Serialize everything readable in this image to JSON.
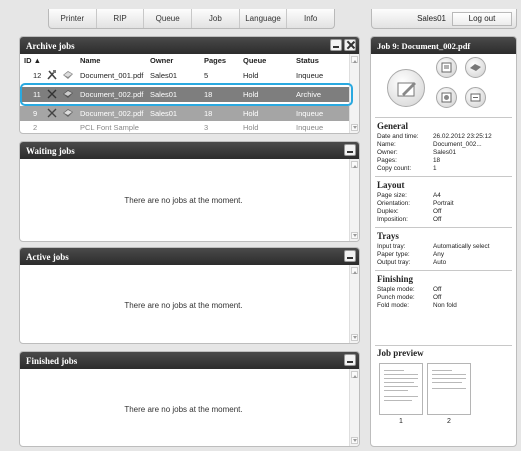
{
  "nav": {
    "tabs": [
      "Printer",
      "RIP",
      "Queue",
      "Job",
      "Language",
      "Info"
    ],
    "user": "Sales01",
    "logout": "Log out"
  },
  "archive": {
    "title": "Archive jobs",
    "columns": [
      "ID ▲",
      "Name",
      "Owner",
      "Pages",
      "Queue",
      "Status"
    ],
    "rows": [
      {
        "id": "12",
        "name": "Document_001.pdf",
        "owner": "Sales01",
        "pages": "5",
        "queue": "Hold",
        "status": "Inqueue"
      },
      {
        "id": "11",
        "name": "Document_002.pdf",
        "owner": "Sales01",
        "pages": "18",
        "queue": "Hold",
        "status": "Archive"
      },
      {
        "id": "9",
        "name": "Document_002.pdf",
        "owner": "Sales01",
        "pages": "18",
        "queue": "Hold",
        "status": "Inqueue"
      },
      {
        "id": "2",
        "name": "PCL Font Sample",
        "owner": "",
        "pages": "3",
        "queue": "Hold",
        "status": "Inqueue"
      }
    ]
  },
  "waiting": {
    "title": "Waiting jobs",
    "empty": "There are no jobs at the moment."
  },
  "active": {
    "title": "Active jobs",
    "empty": "There are no jobs at the moment."
  },
  "finished": {
    "title": "Finished jobs",
    "empty": "There are no jobs at the moment."
  },
  "job": {
    "title": "Job 9: Document_002.pdf",
    "general": {
      "title": "General",
      "items": [
        {
          "k": "Date and time:",
          "v": "26.02.2012 23:25:12"
        },
        {
          "k": "Name:",
          "v": "Document_002..."
        },
        {
          "k": "Owner:",
          "v": "Sales01"
        },
        {
          "k": "Pages:",
          "v": "18"
        },
        {
          "k": "Copy count:",
          "v": "1"
        }
      ]
    },
    "layout": {
      "title": "Layout",
      "items": [
        {
          "k": "Page size:",
          "v": "A4"
        },
        {
          "k": "Orientation:",
          "v": "Portrait"
        },
        {
          "k": "Duplex:",
          "v": "Off"
        },
        {
          "k": "Imposition:",
          "v": "Off"
        }
      ]
    },
    "trays": {
      "title": "Trays",
      "items": [
        {
          "k": "Input tray:",
          "v": "Automatically select"
        },
        {
          "k": "Paper type:",
          "v": "Any"
        },
        {
          "k": "Output tray:",
          "v": "Auto"
        }
      ]
    },
    "finishing": {
      "title": "Finishing",
      "items": [
        {
          "k": "Staple mode:",
          "v": "Off"
        },
        {
          "k": "Punch mode:",
          "v": "Off"
        },
        {
          "k": "Fold mode:",
          "v": "Non fold"
        }
      ]
    },
    "preview": {
      "title": "Job preview",
      "pages": [
        "1",
        "2"
      ]
    }
  }
}
